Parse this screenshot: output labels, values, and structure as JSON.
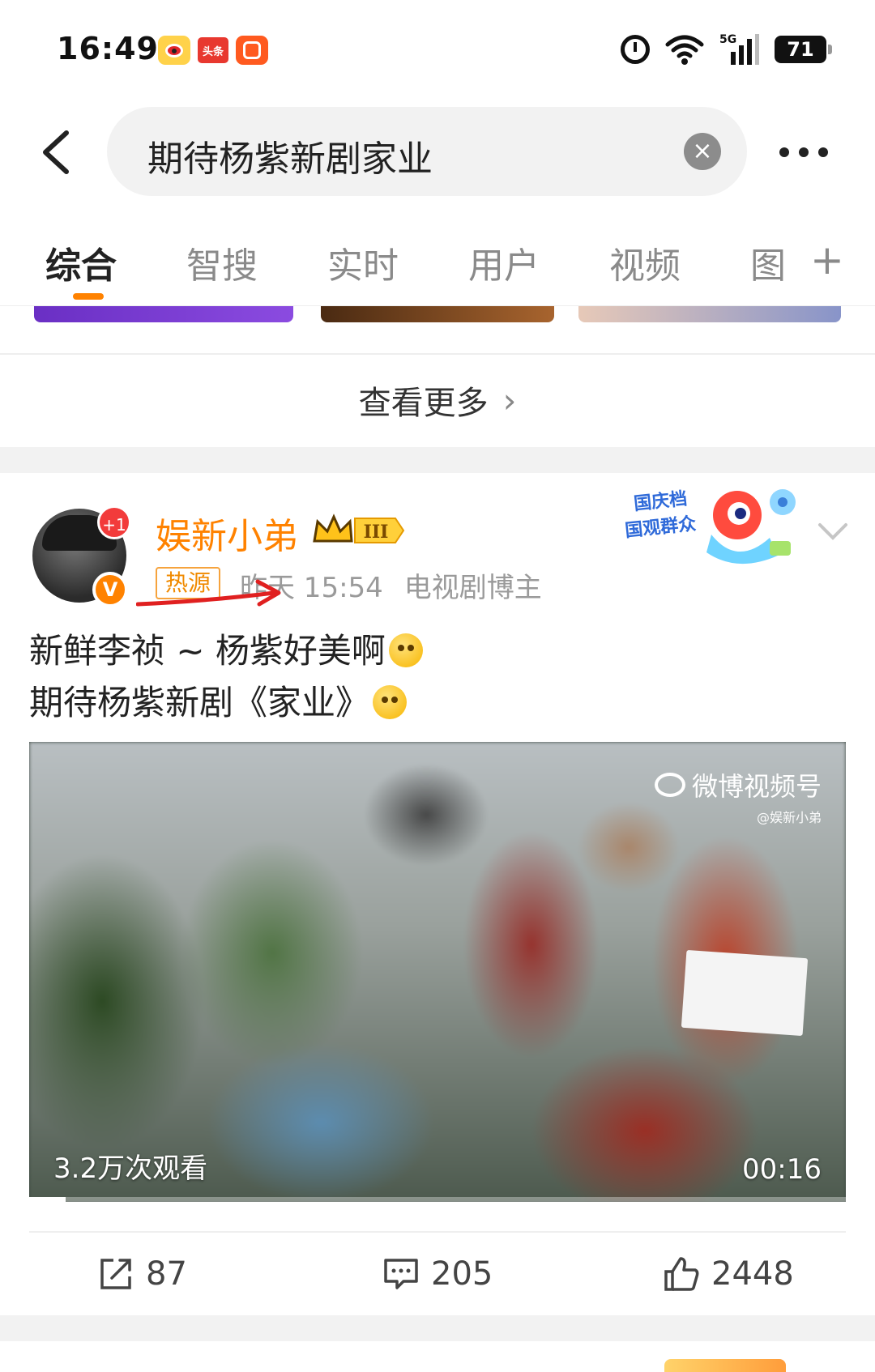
{
  "status_bar": {
    "time": "16:49",
    "app_icons": [
      "weibo-icon",
      "toutiao-icon",
      "kuaishou-icon"
    ],
    "toutiao_label": "头条",
    "network": "5G",
    "battery": "71"
  },
  "search": {
    "query": "期待杨紫新剧家业",
    "clear_icon": "close-icon"
  },
  "tabs": [
    {
      "label": "综合",
      "active": true
    },
    {
      "label": "智搜"
    },
    {
      "label": "实时"
    },
    {
      "label": "用户"
    },
    {
      "label": "视频"
    },
    {
      "label": "图"
    }
  ],
  "see_more": {
    "label": "查看更多"
  },
  "post": {
    "author": "娱新小弟",
    "follow_badge": "+1",
    "verified_badge": "V",
    "level_badge": "III",
    "hot_tag": "热源",
    "time": "昨天 15:54",
    "source": "电视剧博主",
    "mascot_text": [
      "国庆档",
      "国观群众"
    ],
    "text_line1": "新鲜李祯 ~ 杨紫好美啊",
    "text_line2": "期待杨紫新剧《家业》",
    "video": {
      "watermark_title": "微博视频号",
      "watermark_user": "@娱新小弟",
      "views": "3.2万次观看",
      "duration": "00:16",
      "progress": 0.045
    },
    "actions": {
      "repost_count": "87",
      "comment_count": "205",
      "like_count": "2448"
    }
  },
  "colors": {
    "accent": "#ff8200",
    "hot_tag": "#f08a00",
    "annotation_arrow": "#e02020"
  }
}
